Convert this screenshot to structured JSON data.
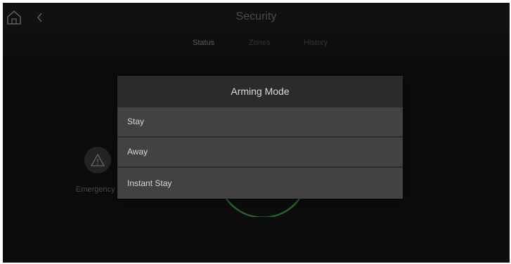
{
  "header": {
    "title": "Security",
    "home_icon": "home-icon",
    "back_icon": "chevron-left-icon"
  },
  "tabs": [
    {
      "label": "Status",
      "active": true
    },
    {
      "label": "Zones",
      "active": false
    },
    {
      "label": "History",
      "active": false
    }
  ],
  "background": {
    "emergency_label": "Emergency",
    "emergency_icon": "warning-icon",
    "status_ring_color": "#2fae3a"
  },
  "dialog": {
    "title": "Arming Mode",
    "options": [
      {
        "label": "Stay"
      },
      {
        "label": "Away"
      },
      {
        "label": "Instant Stay"
      }
    ]
  }
}
